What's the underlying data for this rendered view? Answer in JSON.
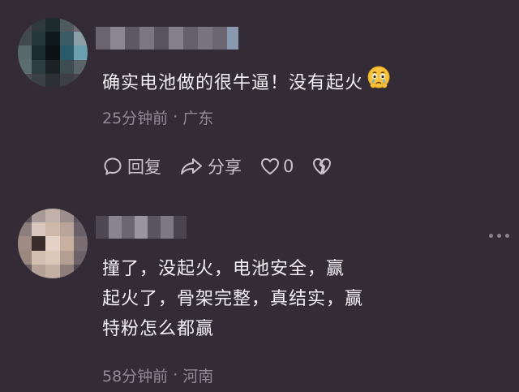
{
  "comments": [
    {
      "content_lines": [
        "确实电池做的很牛逼！没有起火"
      ],
      "emoji": "crying-face",
      "time": "25分钟前",
      "separator": "·",
      "location": "广东",
      "actions": {
        "reply_label": "回复",
        "share_label": "分享",
        "like_count": "0"
      }
    },
    {
      "content_lines": [
        "撞了，没起火，电池安全，赢",
        "起火了，骨架完整，真结实，赢",
        "特粉怎么都赢"
      ],
      "time": "58分钟前",
      "separator": "·",
      "location": "河南"
    }
  ],
  "colors": {
    "background": "#332c36",
    "text": "#f3f0f4",
    "meta": "#928a98",
    "action": "#c9c3cd"
  },
  "icons": [
    "comment-icon",
    "share-icon",
    "heart-icon",
    "broken-heart-icon",
    "more-icon",
    "crying-face-emoji"
  ]
}
